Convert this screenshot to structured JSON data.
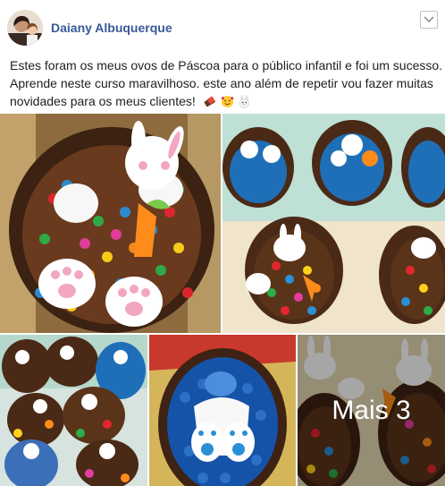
{
  "post": {
    "author_name": "Daiany Albuquerque",
    "text": "Estes foram os meus ovos de Páscoa para o público infantil e foi um sucesso. Aprende neste curso maravilhoso. este ano além de repetir vou fazer muitas novidades para os meus clientes!",
    "emojis": [
      "chocolate-bar-emoji",
      "smiling-face-with-hearts-emoji",
      "rabbit-face-emoji"
    ]
  },
  "gallery": {
    "photos": [
      {
        "name": "easter-egg-photo-1",
        "subject": "chocolate egg with candy and bunny"
      },
      {
        "name": "easter-egg-photo-2",
        "subject": "several eggs with blue candy"
      },
      {
        "name": "easter-egg-photo-3",
        "subject": "many eggs in boxes"
      },
      {
        "name": "easter-egg-photo-4",
        "subject": "egg with blue candy and bunny tail"
      },
      {
        "name": "easter-egg-photo-5",
        "subject": "eggs with bunnies"
      }
    ],
    "more_label": "Mais 3"
  },
  "colors": {
    "author_link": "#385898",
    "text": "#1c1e21",
    "border": "#bec3c9"
  }
}
